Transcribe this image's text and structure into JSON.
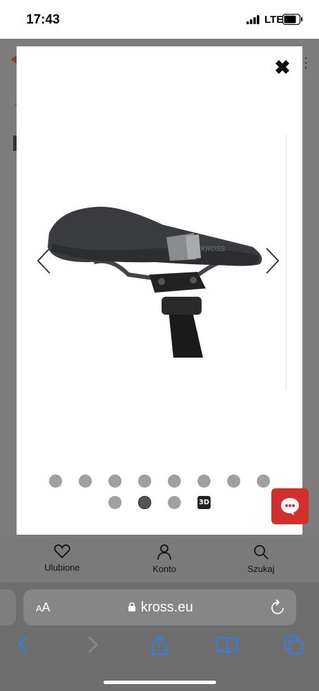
{
  "status_bar": {
    "time": "17:43",
    "network": "LTE"
  },
  "modal": {
    "close_symbol": "✖",
    "image_brand_text": "KROSS",
    "gallery": {
      "total_dots": 11,
      "active_index": 9,
      "has_3d": true,
      "label_3d": "3D"
    }
  },
  "page_nav": {
    "favorites_label": "Ulubione",
    "account_label": "Konto",
    "search_label": "Szukaj"
  },
  "safari": {
    "aa_label_small": "A",
    "aa_label_large": "A",
    "url": "kross.eu"
  },
  "colors": {
    "accent": "#d32f2f",
    "ios_blue": "#2f80ed"
  }
}
